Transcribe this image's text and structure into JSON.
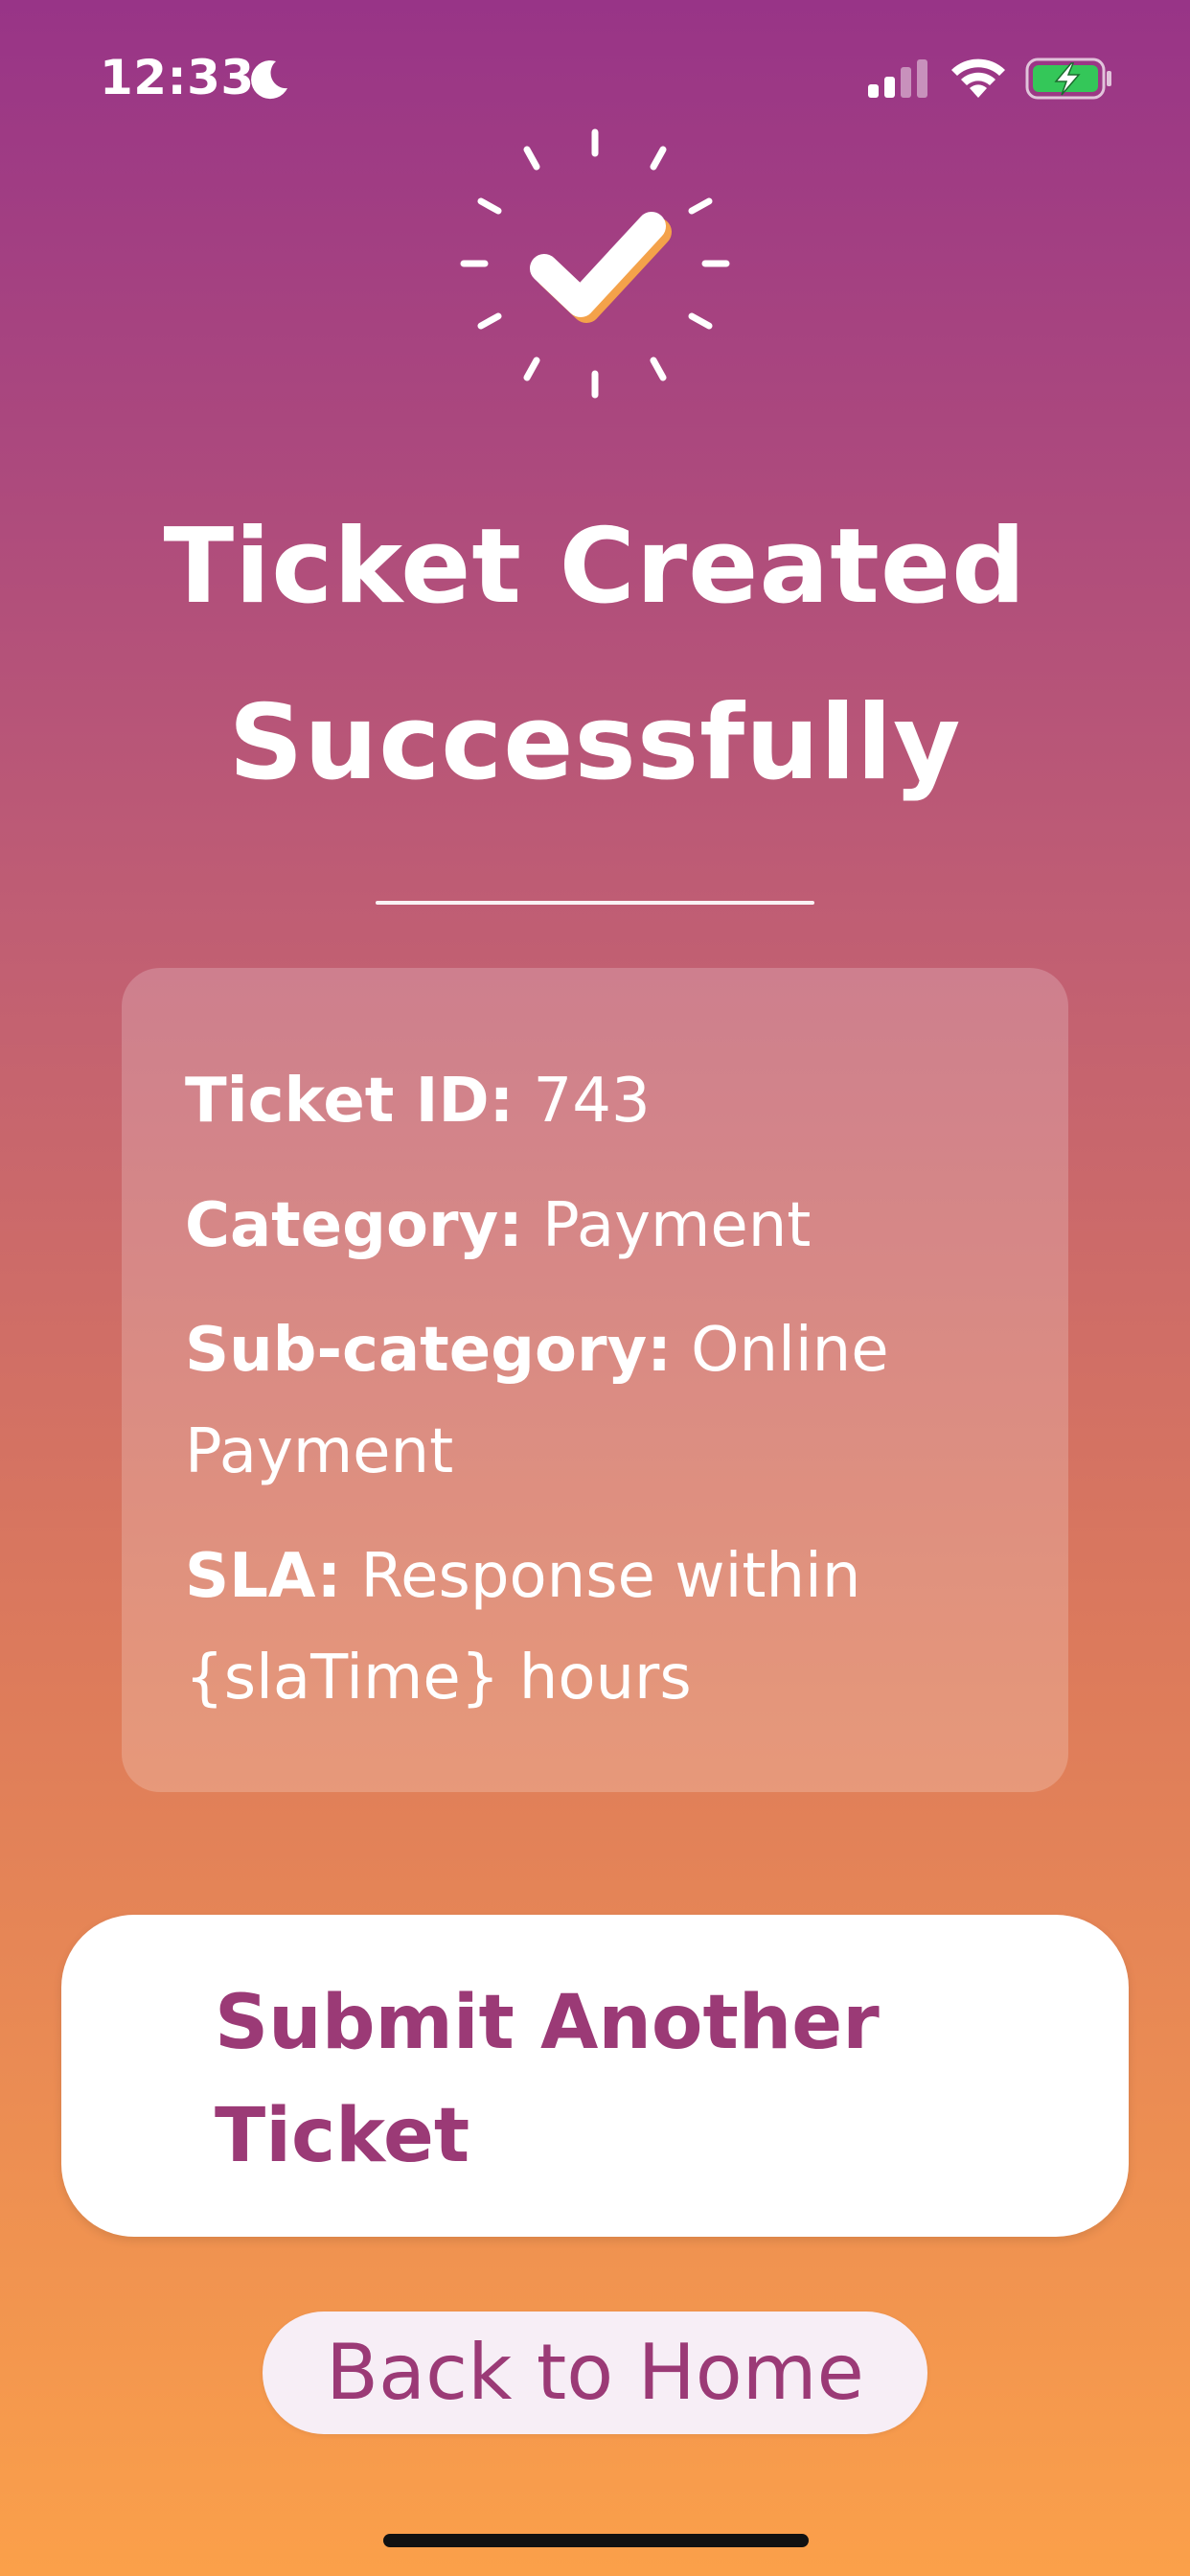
{
  "status_bar": {
    "time": "12:33",
    "icons": [
      "moon-icon",
      "signal-icon",
      "wifi-icon",
      "battery-charging-icon"
    ],
    "battery_color": "#34c759"
  },
  "success_icon": "check-burst-icon",
  "title": {
    "line1": "Ticket Created",
    "line2": "Successfully"
  },
  "ticket": {
    "id_label": "Ticket ID:",
    "id_value": "743",
    "category_label": "Category:",
    "category_value": "Payment",
    "subcategory_label": "Sub-category:",
    "subcategory_value": "Online Payment",
    "sla_label": "SLA:",
    "sla_value": "Response within {slaTime} hours"
  },
  "actions": {
    "submit_another": "Submit Another Ticket",
    "back_home": "Back to Home"
  },
  "colors": {
    "gradient_top": "#983487",
    "gradient_bottom": "#fba04a",
    "accent_text": "#9b3a76",
    "check_shadow": "#f4a24a"
  }
}
